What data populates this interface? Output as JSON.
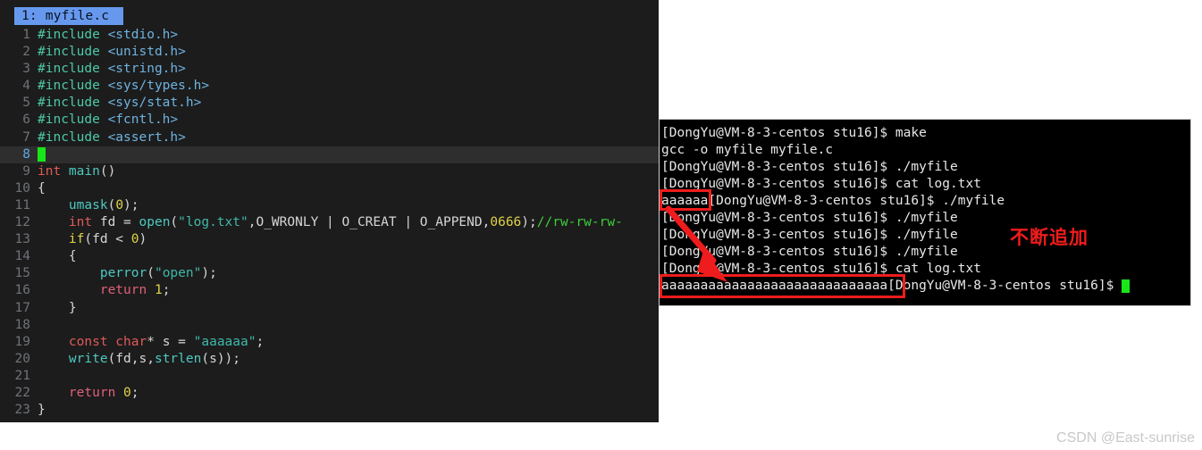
{
  "editor": {
    "tab": {
      "label": "1: myfile.c"
    },
    "current_line": 8,
    "cursor_char": " ",
    "lines": [
      {
        "n": "1",
        "segments": [
          {
            "t": "pre",
            "v": "#include "
          },
          {
            "t": "hdr",
            "v": "<stdio.h>"
          }
        ]
      },
      {
        "n": "2",
        "segments": [
          {
            "t": "pre",
            "v": "#include "
          },
          {
            "t": "hdr",
            "v": "<unistd.h>"
          }
        ]
      },
      {
        "n": "3",
        "segments": [
          {
            "t": "pre",
            "v": "#include "
          },
          {
            "t": "hdr",
            "v": "<string.h>"
          }
        ]
      },
      {
        "n": "4",
        "segments": [
          {
            "t": "pre",
            "v": "#include "
          },
          {
            "t": "hdr",
            "v": "<sys/types.h>"
          }
        ]
      },
      {
        "n": "5",
        "segments": [
          {
            "t": "pre",
            "v": "#include "
          },
          {
            "t": "hdr",
            "v": "<sys/stat.h>"
          }
        ]
      },
      {
        "n": "6",
        "segments": [
          {
            "t": "pre",
            "v": "#include "
          },
          {
            "t": "hdr",
            "v": "<fcntl.h>"
          }
        ]
      },
      {
        "n": "7",
        "segments": [
          {
            "t": "pre",
            "v": "#include "
          },
          {
            "t": "hdr",
            "v": "<assert.h>"
          }
        ]
      },
      {
        "n": "8",
        "segments": [
          {
            "t": "cursor",
            "v": " "
          }
        ]
      },
      {
        "n": "9",
        "segments": [
          {
            "t": "kw",
            "v": "int "
          },
          {
            "t": "fn",
            "v": "main"
          },
          {
            "t": "plain",
            "v": "()"
          }
        ]
      },
      {
        "n": "10",
        "segments": [
          {
            "t": "brace",
            "v": "{"
          }
        ]
      },
      {
        "n": "11",
        "segments": [
          {
            "t": "plain",
            "v": "    "
          },
          {
            "t": "fn",
            "v": "umask"
          },
          {
            "t": "plain",
            "v": "("
          },
          {
            "t": "num",
            "v": "0"
          },
          {
            "t": "plain",
            "v": ");"
          }
        ]
      },
      {
        "n": "12",
        "segments": [
          {
            "t": "plain",
            "v": "    "
          },
          {
            "t": "kw",
            "v": "int "
          },
          {
            "t": "plain",
            "v": "fd = "
          },
          {
            "t": "fn",
            "v": "open"
          },
          {
            "t": "plain",
            "v": "("
          },
          {
            "t": "str",
            "v": "\"log.txt\""
          },
          {
            "t": "plain",
            "v": ",O_WRONLY | O_CREAT | O_APPEND,"
          },
          {
            "t": "num",
            "v": "0666"
          },
          {
            "t": "plain",
            "v": ");"
          },
          {
            "t": "cmt",
            "v": "//rw-rw-rw-"
          }
        ]
      },
      {
        "n": "13",
        "segments": [
          {
            "t": "plain",
            "v": "    "
          },
          {
            "t": "ctrl",
            "v": "if"
          },
          {
            "t": "plain",
            "v": "(fd < "
          },
          {
            "t": "num",
            "v": "0"
          },
          {
            "t": "plain",
            "v": ")"
          }
        ]
      },
      {
        "n": "14",
        "segments": [
          {
            "t": "plain",
            "v": "    "
          },
          {
            "t": "brace",
            "v": "{"
          }
        ]
      },
      {
        "n": "15",
        "segments": [
          {
            "t": "plain",
            "v": "        "
          },
          {
            "t": "fn",
            "v": "perror"
          },
          {
            "t": "plain",
            "v": "("
          },
          {
            "t": "str",
            "v": "\"open\""
          },
          {
            "t": "plain",
            "v": ");"
          }
        ]
      },
      {
        "n": "16",
        "segments": [
          {
            "t": "plain",
            "v": "        "
          },
          {
            "t": "ret",
            "v": "return "
          },
          {
            "t": "num",
            "v": "1"
          },
          {
            "t": "plain",
            "v": ";"
          }
        ]
      },
      {
        "n": "17",
        "segments": [
          {
            "t": "plain",
            "v": "    "
          },
          {
            "t": "brace",
            "v": "}"
          }
        ]
      },
      {
        "n": "18",
        "segments": [
          {
            "t": "plain",
            "v": ""
          }
        ]
      },
      {
        "n": "19",
        "segments": [
          {
            "t": "plain",
            "v": "    "
          },
          {
            "t": "kw",
            "v": "const char"
          },
          {
            "t": "plain",
            "v": "* s = "
          },
          {
            "t": "str",
            "v": "\"aaaaaa\""
          },
          {
            "t": "plain",
            "v": ";"
          }
        ]
      },
      {
        "n": "20",
        "segments": [
          {
            "t": "plain",
            "v": "    "
          },
          {
            "t": "fn",
            "v": "write"
          },
          {
            "t": "plain",
            "v": "(fd,s,"
          },
          {
            "t": "fn",
            "v": "strlen"
          },
          {
            "t": "plain",
            "v": "(s));"
          }
        ]
      },
      {
        "n": "21",
        "segments": [
          {
            "t": "plain",
            "v": ""
          }
        ]
      },
      {
        "n": "22",
        "segments": [
          {
            "t": "plain",
            "v": "    "
          },
          {
            "t": "ret",
            "v": "return "
          },
          {
            "t": "num",
            "v": "0"
          },
          {
            "t": "plain",
            "v": ";"
          }
        ]
      },
      {
        "n": "23",
        "segments": [
          {
            "t": "brace",
            "v": "}"
          }
        ]
      }
    ]
  },
  "terminal": {
    "prompt": "[DongYu@VM-8-3-centos stu16]$ ",
    "lines": [
      {
        "id": "t1",
        "text": "[DongYu@VM-8-3-centos stu16]$ make"
      },
      {
        "id": "t2",
        "text": "gcc -o myfile myfile.c"
      },
      {
        "id": "t3",
        "text": "[DongYu@VM-8-3-centos stu16]$ ./myfile"
      },
      {
        "id": "t4",
        "text": "[DongYu@VM-8-3-centos stu16]$ cat log.txt"
      },
      {
        "id": "t5",
        "text": "aaaaaa[DongYu@VM-8-3-centos stu16]$ ./myfile"
      },
      {
        "id": "t6",
        "text": "[DongYu@VM-8-3-centos stu16]$ ./myfile"
      },
      {
        "id": "t7",
        "text": "[DongYu@VM-8-3-centos stu16]$ ./myfile"
      },
      {
        "id": "t8",
        "text": "[DongYu@VM-8-3-centos stu16]$ ./myfile"
      },
      {
        "id": "t9",
        "text": "[DongYu@VM-8-3-centos stu16]$ cat log.txt"
      },
      {
        "id": "t10",
        "text": "aaaaaaaaaaaaaaaaaaaaaaaaaaaaa[DongYu@VM-8-3-centos stu16]$ "
      }
    ]
  },
  "annotations": {
    "note_cn": "不断追加",
    "accent_red": "#ee1c1c",
    "highlight_small_label": "aaaaaa",
    "highlight_long_label": "aaaaaaaaaaaaaaaaaaaaaaaaaaaaa"
  },
  "watermark": {
    "text": "CSDN @East-sunrise"
  }
}
